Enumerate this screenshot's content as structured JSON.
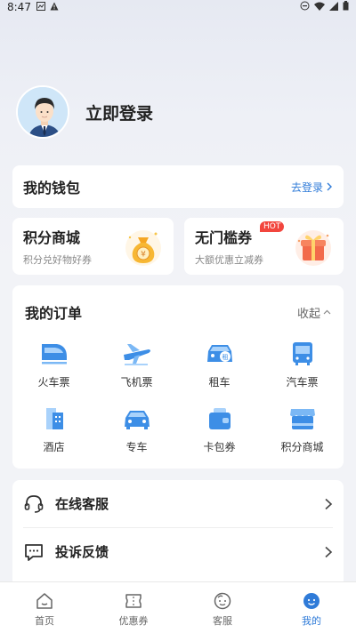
{
  "status_bar": {
    "time": "8:47"
  },
  "profile": {
    "login_label": "立即登录"
  },
  "wallet": {
    "title": "我的钱包",
    "link": "去登录"
  },
  "promos": [
    {
      "title": "积分商城",
      "subtitle": "积分兑好物好券",
      "icon": "coin-bag-icon"
    },
    {
      "title": "无门槛券",
      "subtitle": "大额优惠立减券",
      "badge": "HOT",
      "icon": "gift-box-icon"
    }
  ],
  "orders": {
    "title": "我的订单",
    "collapse_label": "收起",
    "items": [
      {
        "label": "火车票",
        "icon": "train-icon"
      },
      {
        "label": "飞机票",
        "icon": "airplane-icon"
      },
      {
        "label": "租车",
        "icon": "car-rental-icon"
      },
      {
        "label": "汽车票",
        "icon": "bus-icon"
      },
      {
        "label": "酒店",
        "icon": "hotel-icon"
      },
      {
        "label": "专车",
        "icon": "car-icon"
      },
      {
        "label": "卡包券",
        "icon": "wallet-card-icon"
      },
      {
        "label": "积分商城",
        "icon": "store-icon"
      }
    ]
  },
  "service": {
    "items": [
      {
        "label": "在线客服",
        "icon": "headset-icon"
      },
      {
        "label": "投诉反馈",
        "icon": "feedback-icon"
      }
    ]
  },
  "tabbar": {
    "items": [
      {
        "label": "首页",
        "icon": "home-icon"
      },
      {
        "label": "优惠券",
        "icon": "coupon-icon"
      },
      {
        "label": "客服",
        "icon": "service-icon"
      },
      {
        "label": "我的",
        "icon": "profile-icon"
      }
    ],
    "active_index": 3
  },
  "colors": {
    "accent": "#2f7bd8",
    "icon_blue": "#3d8ee6",
    "hot": "#f2463e"
  }
}
